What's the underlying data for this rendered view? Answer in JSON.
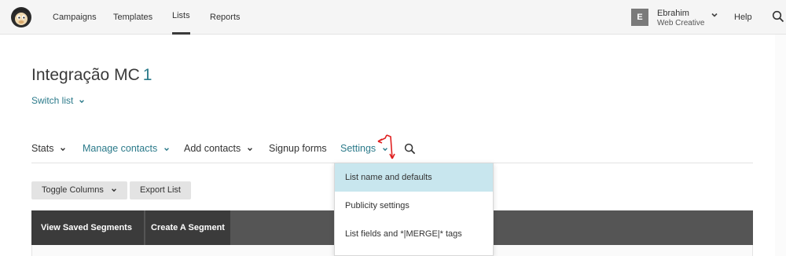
{
  "topbar": {
    "nav": [
      "Campaigns",
      "Templates",
      "Lists",
      "Reports"
    ],
    "active": "Lists",
    "user": {
      "initial": "E",
      "name": "Ebrahim",
      "org": "Web Creative"
    },
    "help": "Help"
  },
  "page": {
    "title": "Integração MC",
    "title_number": "1",
    "switch_list": "Switch list"
  },
  "subnav": {
    "stats": "Stats",
    "manage_contacts": "Manage contacts",
    "add_contacts": "Add contacts",
    "signup_forms": "Signup forms",
    "settings": "Settings"
  },
  "buttons": {
    "toggle_columns": "Toggle Columns",
    "export_list": "Export List"
  },
  "segments": {
    "view_saved": "View Saved Segments",
    "create": "Create A Segment"
  },
  "settings_menu": {
    "items": [
      "List name and defaults",
      "Publicity settings",
      "List fields and *|MERGE|* tags"
    ],
    "highlighted": "List name and defaults"
  },
  "colors": {
    "link": "#2b7a8a",
    "annotation": "#e02020",
    "segment_bar": "#555555",
    "highlight": "#c8e6ee"
  },
  "icons": [
    "mailchimp-logo-icon",
    "chevron-down-icon",
    "search-icon",
    "red-arrow-icon"
  ]
}
